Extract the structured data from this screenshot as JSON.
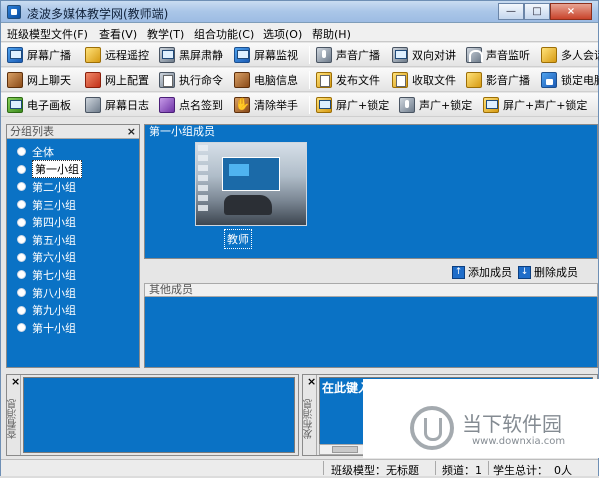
{
  "window": {
    "title": "凌波多媒体教学网(教师端)",
    "controls": [
      "—",
      "□",
      "×"
    ]
  },
  "menu": [
    "班级模型文件(F)",
    "查看(V)",
    "教学(T)",
    "组合功能(C)",
    "选项(O)",
    "帮助(H)"
  ],
  "toolbar1": [
    {
      "label": "屏幕广播",
      "icon": "screen-broadcast-icon"
    },
    {
      "label": "远程遥控",
      "icon": "remote-control-icon"
    },
    {
      "label": "黑屏肃静",
      "icon": "black-screen-icon"
    },
    {
      "label": "屏幕监视",
      "icon": "screen-monitor-icon"
    },
    {
      "label": "声音广播",
      "icon": "microphone-icon"
    },
    {
      "label": "双向对讲",
      "icon": "intercom-icon"
    },
    {
      "label": "声音监听",
      "icon": "headphones-icon"
    },
    {
      "label": "多人会话",
      "icon": "group-chat-icon"
    }
  ],
  "toolbar2": [
    {
      "label": "网上聊天",
      "icon": "chat-icon"
    },
    {
      "label": "网上配置",
      "icon": "config-icon"
    },
    {
      "label": "执行命令",
      "icon": "execute-icon"
    },
    {
      "label": "电脑信息",
      "icon": "pc-info-icon"
    },
    {
      "label": "发布文件",
      "icon": "publish-file-icon"
    },
    {
      "label": "收取文件",
      "icon": "collect-file-icon"
    },
    {
      "label": "影音广播",
      "icon": "video-broadcast-icon"
    },
    {
      "label": "锁定电脑",
      "icon": "lock-pc-icon"
    }
  ],
  "toolbar3": [
    {
      "label": "电子画板",
      "icon": "whiteboard-icon"
    },
    {
      "label": "屏幕日志",
      "icon": "screen-log-icon"
    },
    {
      "label": "点名签到",
      "icon": "roll-call-icon"
    },
    {
      "label": "清除举手",
      "icon": "clear-hand-icon"
    },
    {
      "label": "屏广+锁定",
      "icon": "screen-lock-icon"
    },
    {
      "label": "声广+锁定",
      "icon": "sound-lock-icon"
    },
    {
      "label": "屏广+声广+锁定",
      "icon": "screen-sound-lock-icon"
    }
  ],
  "groups": {
    "title": "分组列表",
    "close": "×",
    "items": [
      "全体",
      "第一小组",
      "第二小组",
      "第三小组",
      "第四小组",
      "第五小组",
      "第六小组",
      "第七小组",
      "第八小组",
      "第九小组",
      "第十小组"
    ],
    "selected_index": 1
  },
  "members": {
    "title": "第一小组成员",
    "thumb_label": "教师",
    "add": "添加成员",
    "remove": "删除成员"
  },
  "others": {
    "title": "其他成员"
  },
  "bottom_left": {
    "tab": "查看消息",
    "close": "×"
  },
  "bottom_right": {
    "tab": "发布消息",
    "text": "在此键入消息，回车送出",
    "close": "×"
  },
  "watermark": {
    "title": "当下软件园",
    "url": "www.downxia.com"
  },
  "status": {
    "model": "班级模型：无标题",
    "channel": "频道：1",
    "students": "学生总计：",
    "count": "0人"
  }
}
